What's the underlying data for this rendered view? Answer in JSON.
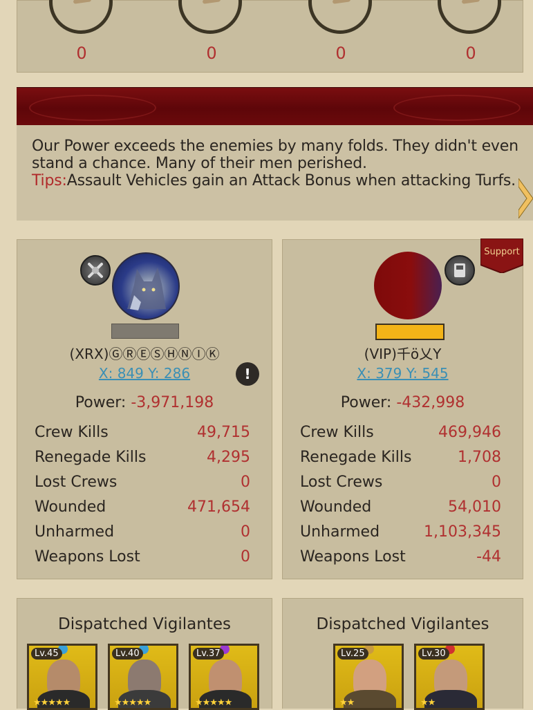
{
  "top_counts": [
    "0",
    "0",
    "0",
    "0"
  ],
  "message": {
    "text": "Our Power exceeds the enemies by many folds. They didn't even stand a chance. Many of their men perished.",
    "tips_label": "Tips:",
    "tips_text": "Assault Vehicles gain an Attack Bonus when attacking Turfs."
  },
  "left_player": {
    "name": "(XRX)ⒼⓇⒺⓈⒽⓃⒾⓀ",
    "coords": "X: 849 Y: 286",
    "power_label": "Power: ",
    "power_value": "-3,971,198",
    "stats": [
      {
        "label": "Crew Kills",
        "value": "49,715"
      },
      {
        "label": "Renegade Kills",
        "value": "4,295"
      },
      {
        "label": "Lost Crews",
        "value": "0"
      },
      {
        "label": "Wounded",
        "value": "471,654"
      },
      {
        "label": "Unharmed",
        "value": "0"
      },
      {
        "label": "Weapons Lost",
        "value": "0"
      }
    ]
  },
  "right_player": {
    "badge": "Support",
    "name": "(VIP)千ö乂Y",
    "coords": "X: 379 Y: 545",
    "power_label": "Power: ",
    "power_value": "-432,998",
    "stats": [
      {
        "label": "Crew Kills",
        "value": "469,946"
      },
      {
        "label": "Renegade Kills",
        "value": "1,708"
      },
      {
        "label": "Lost Crews",
        "value": "0"
      },
      {
        "label": "Wounded",
        "value": "54,010"
      },
      {
        "label": "Unharmed",
        "value": "1,103,345"
      },
      {
        "label": "Weapons Lost",
        "value": "-44"
      }
    ]
  },
  "dispatched": {
    "title": "Dispatched Vigilantes",
    "left_cards": [
      {
        "level": "Lv.45",
        "gem_color": "#3aa0d8",
        "stars": "★★★★★"
      },
      {
        "level": "Lv.40",
        "gem_color": "#3aa0d8",
        "stars": "★★★★★"
      },
      {
        "level": "Lv.37",
        "gem_color": "#9a3ad0",
        "stars": "★★★★★"
      }
    ],
    "right_cards": [
      {
        "level": "Lv.25",
        "gem_color": "#c89a40",
        "stars": "★★"
      },
      {
        "level": "Lv.30",
        "gem_color": "#d03030",
        "stars": "★★"
      }
    ]
  },
  "colors": {
    "background": "#e2d6b8",
    "panel": "#c8bd9f",
    "banner": "#6b0a0c",
    "negative_value": "#b03030",
    "link": "#3a8fb5",
    "gold_bar": "#f3b418"
  },
  "icons": {
    "left_badge": "crossed-weapons-icon",
    "right_badge": "shield-icon",
    "alert": "exclamation-icon",
    "next": "chevron-right-icon"
  }
}
